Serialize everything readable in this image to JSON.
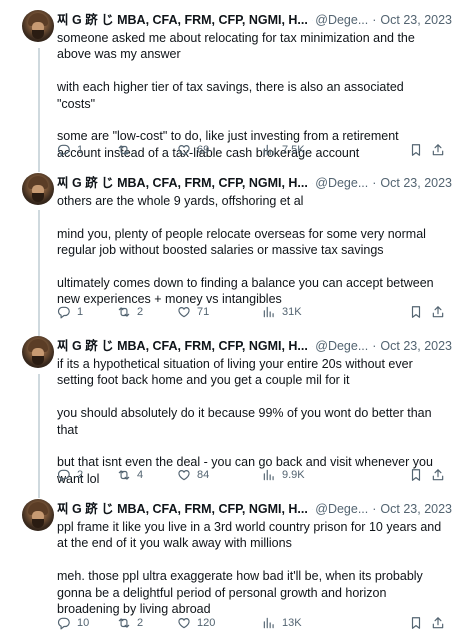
{
  "author": {
    "name": "찌 G 跻 じ MBA, CFA, FRM, CFP, NGMI, H...",
    "handle": "@Dege...",
    "verified_color": "#1d9bf0"
  },
  "icons": {
    "reply": "reply-icon",
    "retweet": "retweet-icon",
    "like": "heart-icon",
    "views": "views-chart-icon",
    "bookmark": "bookmark-icon",
    "share": "share-icon",
    "more": "more-icon"
  },
  "more_label": "···",
  "separator": "·",
  "tweets": [
    {
      "date": "Oct 23, 2023",
      "paragraphs": [
        "someone asked me about relocating for tax minimization and the above was my answer",
        "with each higher tier of tax savings, there is also an associated \"costs\"",
        "some are \"low-cost\" to do, like just investing from a retirement account instead of a tax-liable cash brokerage account"
      ],
      "replies": "1",
      "retweets": "",
      "likes": "69",
      "views": "7.5K"
    },
    {
      "date": "Oct 23, 2023",
      "paragraphs": [
        "others are the whole 9 yards, offshoring et al",
        "mind you, plenty of people relocate overseas for some very normal regular job without boosted salaries or massive tax savings",
        "ultimately comes down to finding a balance you can accept between new experiences + money vs intangibles"
      ],
      "replies": "1",
      "retweets": "2",
      "likes": "71",
      "views": "31K"
    },
    {
      "date": "Oct 23, 2023",
      "paragraphs": [
        "if its a hypothetical situation of living your entire 20s without ever setting foot back home and you get a couple mil for it",
        "you should absolutely do it because 99% of you wont do better than that",
        "but that isnt even the deal - you can go back and visit whenever you want lol"
      ],
      "replies": "2",
      "retweets": "4",
      "likes": "84",
      "views": "9.9K"
    },
    {
      "date": "Oct 23, 2023",
      "paragraphs": [
        "ppl frame it like you live in a 3rd world country prison for 10 years and at the end of it you walk away with millions",
        "meh. those ppl ultra exaggerate how bad it'll be, when its probably gonna be a delightful period of personal growth and horizon broadening by living abroad"
      ],
      "replies": "10",
      "retweets": "2",
      "likes": "120",
      "views": "13K"
    }
  ]
}
